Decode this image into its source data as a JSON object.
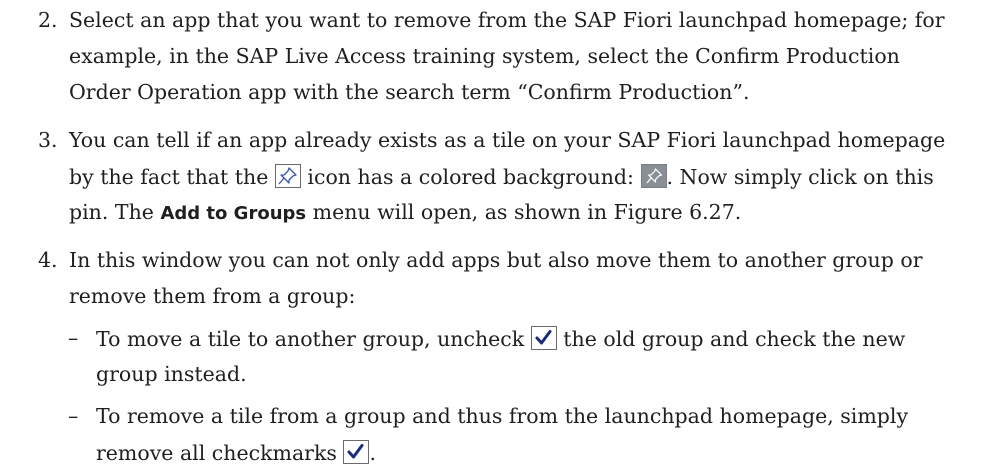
{
  "items": [
    {
      "num": "2.",
      "lines": [
        "Select an app that you want to remove from the SAP Fiori launchpad homepage; for",
        "example, in the SAP Live Access training system, select the Confirm Production",
        "Order Operation app with the search term “Confirm Production”."
      ]
    },
    {
      "num": "3.",
      "line1": "You can tell if an app already exists as a tile on your SAP Fiori launchpad homepage",
      "line2_a": "by the fact that the",
      "line2_b": "icon has a colored background:",
      "line2_c": ". Now simply click on this",
      "line3_a": "pin. The",
      "line3_bold": "Add to Groups",
      "line3_b": "menu will open, as shown in Figure 6.27."
    },
    {
      "num": "4.",
      "line1": "In this window you can not only add apps but also move them to another group or",
      "line2": "remove them from a group:",
      "sub": [
        {
          "dash": "–",
          "line1_a": "To move a tile to another group, uncheck",
          "line1_b": "the old group and check the new",
          "line2": "group instead."
        },
        {
          "dash": "–",
          "line1": "To remove a tile from a group and thus from the launchpad homepage, simply",
          "line2_a": "remove all checkmarks",
          "line2_b": "."
        }
      ]
    }
  ],
  "icons": {
    "pin_outline": "pin-icon",
    "pin_filled": "pin-filled-icon",
    "checkmark": "checkmark-icon",
    "pin_filled_bg": "#8a8f96",
    "checkmark_color": "#1a2a8a"
  }
}
